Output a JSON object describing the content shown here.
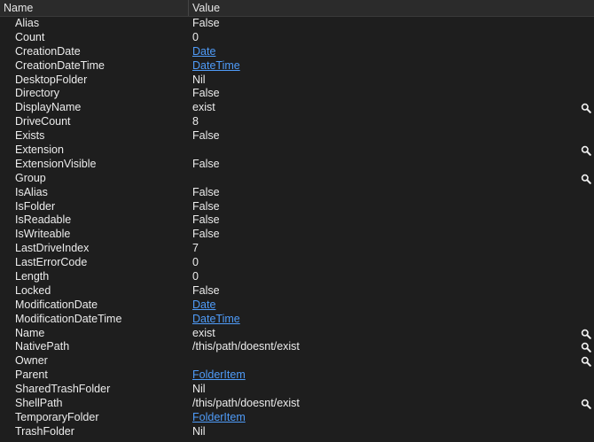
{
  "columns": {
    "name": "Name",
    "value": "Value"
  },
  "colors": {
    "background": "#1e1e1e",
    "header": "#2b2b2b",
    "text": "#ececec",
    "link": "#4f9cf9"
  },
  "rows": [
    {
      "name": "Alias",
      "value": "False",
      "link": false,
      "inspect": false
    },
    {
      "name": "Count",
      "value": "0",
      "link": false,
      "inspect": false
    },
    {
      "name": "CreationDate",
      "value": "Date",
      "link": true,
      "inspect": false
    },
    {
      "name": "CreationDateTime",
      "value": "DateTime",
      "link": true,
      "inspect": false
    },
    {
      "name": "DesktopFolder",
      "value": "Nil",
      "link": false,
      "inspect": false
    },
    {
      "name": "Directory",
      "value": "False",
      "link": false,
      "inspect": false
    },
    {
      "name": "DisplayName",
      "value": "exist",
      "link": false,
      "inspect": true
    },
    {
      "name": "DriveCount",
      "value": "8",
      "link": false,
      "inspect": false
    },
    {
      "name": "Exists",
      "value": "False",
      "link": false,
      "inspect": false
    },
    {
      "name": "Extension",
      "value": "",
      "link": false,
      "inspect": true
    },
    {
      "name": "ExtensionVisible",
      "value": "False",
      "link": false,
      "inspect": false
    },
    {
      "name": "Group",
      "value": "",
      "link": false,
      "inspect": true
    },
    {
      "name": "IsAlias",
      "value": "False",
      "link": false,
      "inspect": false
    },
    {
      "name": "IsFolder",
      "value": "False",
      "link": false,
      "inspect": false
    },
    {
      "name": "IsReadable",
      "value": "False",
      "link": false,
      "inspect": false
    },
    {
      "name": "IsWriteable",
      "value": "False",
      "link": false,
      "inspect": false
    },
    {
      "name": "LastDriveIndex",
      "value": "7",
      "link": false,
      "inspect": false
    },
    {
      "name": "LastErrorCode",
      "value": "0",
      "link": false,
      "inspect": false
    },
    {
      "name": "Length",
      "value": "0",
      "link": false,
      "inspect": false
    },
    {
      "name": "Locked",
      "value": "False",
      "link": false,
      "inspect": false
    },
    {
      "name": "ModificationDate",
      "value": "Date",
      "link": true,
      "inspect": false
    },
    {
      "name": "ModificationDateTime",
      "value": "DateTime",
      "link": true,
      "inspect": false
    },
    {
      "name": "Name",
      "value": "exist",
      "link": false,
      "inspect": true
    },
    {
      "name": "NativePath",
      "value": "/this/path/doesnt/exist",
      "link": false,
      "inspect": true
    },
    {
      "name": "Owner",
      "value": "",
      "link": false,
      "inspect": true
    },
    {
      "name": "Parent",
      "value": "FolderItem",
      "link": true,
      "inspect": false
    },
    {
      "name": "SharedTrashFolder",
      "value": "Nil",
      "link": false,
      "inspect": false
    },
    {
      "name": "ShellPath",
      "value": "/this/path/doesnt/exist",
      "link": false,
      "inspect": true
    },
    {
      "name": "TemporaryFolder",
      "value": "FolderItem",
      "link": true,
      "inspect": false
    },
    {
      "name": "TrashFolder",
      "value": "Nil",
      "link": false,
      "inspect": false
    }
  ]
}
